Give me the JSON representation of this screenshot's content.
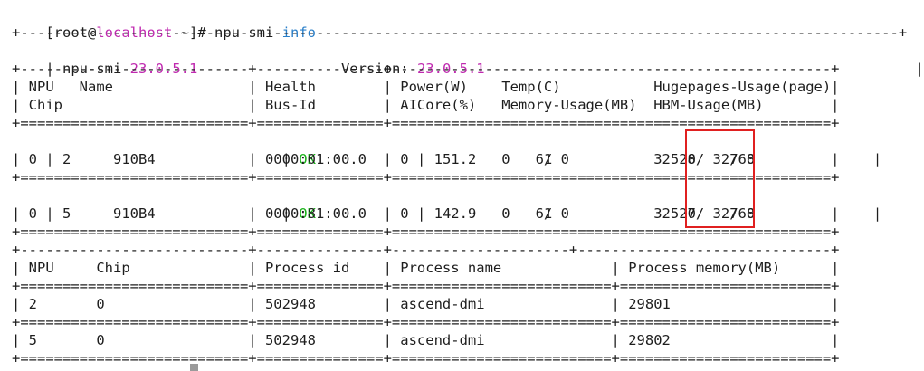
{
  "prompt": {
    "user_host_prefix": "[root@",
    "host": "localhost",
    "cwd_suffix": " ~]# ",
    "command": "npu-smi ",
    "arg": "info"
  },
  "header_table": {
    "border_top": "+--------------------------------------------------------------------------------------------------------+",
    "npu_smi_label": "| npu-smi ",
    "npu_smi_version": "23.0.5.1",
    "version_gap": "                 Version: ",
    "version_value": "23.0.5.1",
    "version_end": "                                                   |",
    "divider": "+---------------------------+---------------+----------------------------------------------------+",
    "head_row1": "| NPU   Name                | Health        | Power(W)    Temp(C)           Hugepages-Usage(page)|",
    "head_row2": "| Chip                      | Bus-Id        | AICore(%)   Memory-Usage(MB)  HBM-Usage(MB)        |",
    "heavy_divider": "+===========================+===============+====================================================+"
  },
  "devices": [
    {
      "row1_a": "| 2     910B4               | ",
      "health": "OK",
      "row1_b": "            | 151.2       61                0    / 0              |",
      "row2": "| 0                         | 0000:01:00.0  | 0           0    / 0          32528/ 32768         |",
      "npu": "2",
      "name": "910B4",
      "chip": "0",
      "bus_id": "0000:01:00.0",
      "power_w": "151.2",
      "temp_c": "61",
      "hugepages_used": "0",
      "hugepages_total": "0",
      "aicore_pct": "0",
      "memory_used": "0",
      "memory_total": "0",
      "hbm_used": "32528",
      "hbm_total": "32768"
    },
    {
      "row1_a": "| 5     910B4               | ",
      "health": "OK",
      "row1_b": "            | 142.9       61                0    / 0              |",
      "row2": "| 0                         | 0000:81:00.0  | 0           0    / 0          32527/ 32768         |",
      "npu": "5",
      "name": "910B4",
      "chip": "0",
      "bus_id": "0000:81:00.0",
      "power_w": "142.9",
      "temp_c": "61",
      "hugepages_used": "0",
      "hugepages_total": "0",
      "aicore_pct": "0",
      "memory_used": "0",
      "memory_total": "0",
      "hbm_used": "32527",
      "hbm_total": "32768"
    }
  ],
  "process_table": {
    "divider": "+---------------------------+---------------+----------------------------------------------------+",
    "divider2": "+---------------------------+---------------+---------------------+------------------------------+",
    "header": "| NPU     Chip              | Process id    | Process name             | Process memory(MB)      |",
    "heavy_divider": "+===========================+===============+==========================+=========================+",
    "rows": [
      {
        "line": "| 2       0                 | 502948        | ascend-dmi               | 29801                   |",
        "npu": "2",
        "chip": "0",
        "pid": "502948",
        "name": "ascend-dmi",
        "memory_mb": "29801"
      },
      {
        "line": "| 5       0                 | 502948        | ascend-dmi               | 29802                   |",
        "npu": "5",
        "chip": "0",
        "pid": "502948",
        "name": "ascend-dmi",
        "memory_mb": "29802"
      }
    ]
  },
  "colors": {
    "highlight": "#e02020",
    "version": "#c02ab0",
    "status_ok": "#19b219",
    "arg": "#2a7fc9"
  }
}
